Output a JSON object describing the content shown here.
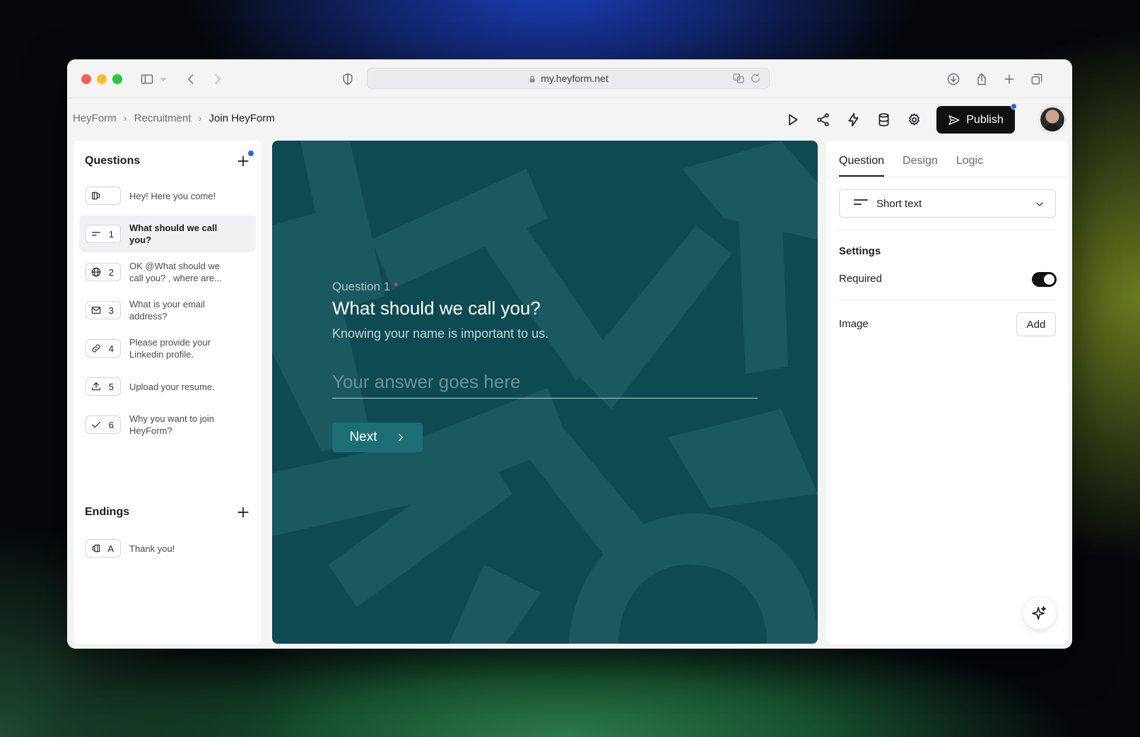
{
  "browser": {
    "url": "my.heyform.net"
  },
  "breadcrumb": [
    {
      "label": "HeyForm"
    },
    {
      "label": "Recruitment"
    },
    {
      "label": "Join HeyForm"
    }
  ],
  "toolbar": {
    "publish_label": "Publish",
    "icons": [
      "play-icon",
      "share-icon",
      "lightning-icon",
      "database-icon",
      "gear-icon"
    ]
  },
  "questions_panel": {
    "title": "Questions",
    "items": [
      {
        "number": "",
        "icon": "welcome-icon",
        "label": "Hey! Here you come!"
      },
      {
        "number": "1",
        "icon": "short-text-icon",
        "label": "What should we call you?"
      },
      {
        "number": "2",
        "icon": "globe-icon",
        "label": "OK @What should we call you? , where are..."
      },
      {
        "number": "3",
        "icon": "mail-icon",
        "label": "What is your email address?"
      },
      {
        "number": "4",
        "icon": "link-icon",
        "label": "Please provide your Linkedin profile."
      },
      {
        "number": "5",
        "icon": "upload-icon",
        "label": "Upload your resume."
      },
      {
        "number": "6",
        "icon": "check-icon",
        "label": "Why you want to join HeyForm?"
      }
    ],
    "endings_title": "Endings",
    "endings": [
      {
        "number": "A",
        "icon": "ending-icon",
        "label": "Thank you!"
      }
    ]
  },
  "preview": {
    "question_number": "Question 1",
    "required_mark": "*",
    "title": "What should we call you?",
    "description": "Knowing your name is important to us.",
    "answer_placeholder": "Your answer goes here",
    "next_label": "Next",
    "background_color": "#0e4a52"
  },
  "properties": {
    "tabs": [
      {
        "label": "Question",
        "active": true
      },
      {
        "label": "Design",
        "active": false
      },
      {
        "label": "Logic",
        "active": false
      }
    ],
    "type_select": "Short text",
    "settings_title": "Settings",
    "required_label": "Required",
    "required_on": true,
    "image_label": "Image",
    "image_add_label": "Add"
  },
  "colors": {
    "accent_dot": "#2563eb",
    "publish_bg": "#111111",
    "required_star": "#e05a52"
  }
}
